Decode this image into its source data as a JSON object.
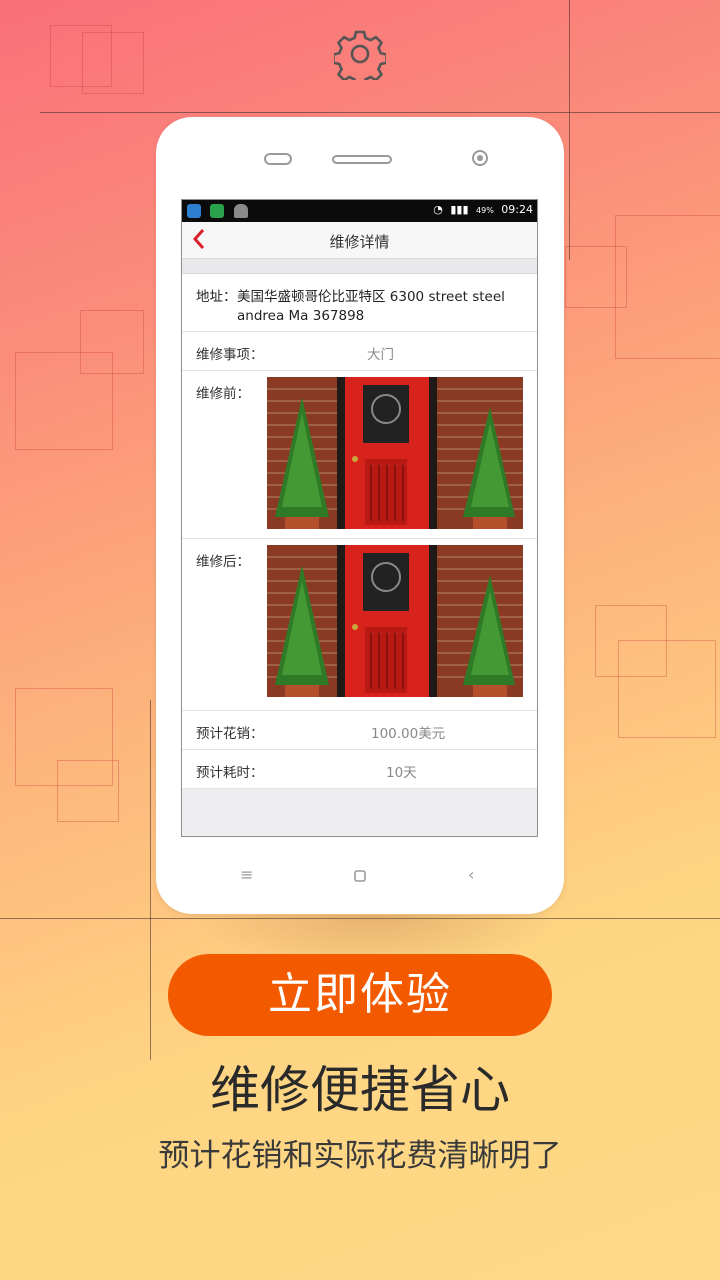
{
  "screen": {
    "nav_title": "维修详情",
    "back_label": "‹",
    "status_time": "09:24",
    "status_battery": "49%",
    "address_label": "地址：",
    "address_value": "美国华盛顿哥伦比亚特区 6300 street steel andrea Ma 367898",
    "item_label": "维修事项：",
    "item_value": "大门",
    "before_label": "维修前：",
    "after_label": "维修后：",
    "cost_label": "预计花销：",
    "cost_value": "100.00美元",
    "time_label": "预计耗时：",
    "time_value": "10天"
  },
  "cta_label": "立即体验",
  "headline": "维修便捷省心",
  "subline": "预计花销和实际花费清晰明了",
  "colors": {
    "cta": "#f35a00",
    "back_arrow": "#d8202a"
  },
  "icons": [
    "gear-icon",
    "back-icon",
    "menu-icon",
    "home-icon",
    "back-nav-icon"
  ]
}
